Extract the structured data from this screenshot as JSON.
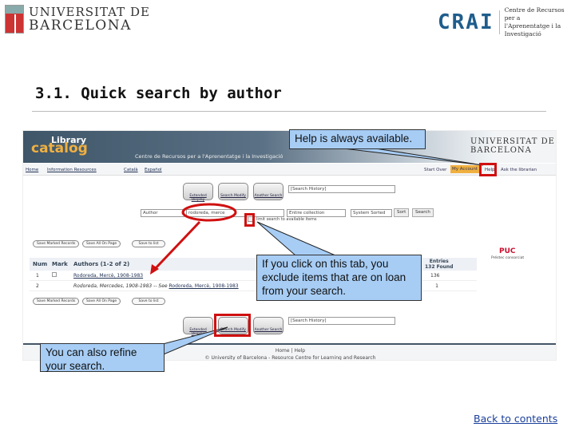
{
  "header": {
    "ub_logo_line1": "UNIVERSITAT DE",
    "ub_logo_line2": "BARCELONA",
    "crai_logo": "CRAI",
    "crai_line1": "Centre de Recursos per a",
    "crai_line2": "l'Aprenentatge i la Investigació"
  },
  "slide_title": "3.1. Quick search by author",
  "catalog": {
    "brand_line1": "Library",
    "brand_line2": "catalog",
    "centre": "Centre de Recursos per a l'Aprenentatge i la Investigació",
    "ub_line1": "UNIVERSITAT DE",
    "ub_line2": "BARCELONA",
    "nav": {
      "home": "Home",
      "information_resources": "Information Resources",
      "catala": "Català",
      "espanol": "Español",
      "start_over": "Start Over",
      "my_account": "My Account",
      "help": "Help",
      "ask": "Ask the librarian"
    },
    "tool_buttons": [
      "Extended Display",
      "Search Modify",
      "Another Search"
    ],
    "search_history": "[Search History]",
    "search": {
      "field": "Author",
      "term": "rodoreda, merce",
      "scope": "Entire collection",
      "sort": "System Sorted",
      "sort_btn": "Sort",
      "search_btn": "Search",
      "limit": "limit search to available items"
    },
    "list_buttons": [
      "Save Marked Records",
      "Save All On Page",
      "Save to list"
    ],
    "puc": "PUC",
    "puc_sub": "Préstec consorciat",
    "table": {
      "headers": [
        "Num",
        "Mark",
        "Authors (1-2 of 2)",
        "Entries",
        "132 Found"
      ],
      "rows": [
        {
          "num": "1",
          "author": "Rodoreda, Mercè, 1908-1983",
          "see": "",
          "entries": "136"
        },
        {
          "num": "2",
          "author": "Rodoreda, Mercedes, 1908-1983 -- See",
          "see": "Rodoreda, Mercè, 1908-1983",
          "entries": "1"
        }
      ]
    },
    "footer": {
      "home": "Home",
      "help": "Help",
      "copyright": "© University of Barcelona - Resource Centre for Learning and Research"
    }
  },
  "callouts": {
    "help": "Help is always available.",
    "limit": "If you click on this tab, you exclude items that are on loan from your search.",
    "refine": "You can also refine your search."
  },
  "back_link": "Back to contents",
  "colors": {
    "callout": "#a7cdf5",
    "highlight": "#d01010",
    "link": "#1a3f9c"
  }
}
